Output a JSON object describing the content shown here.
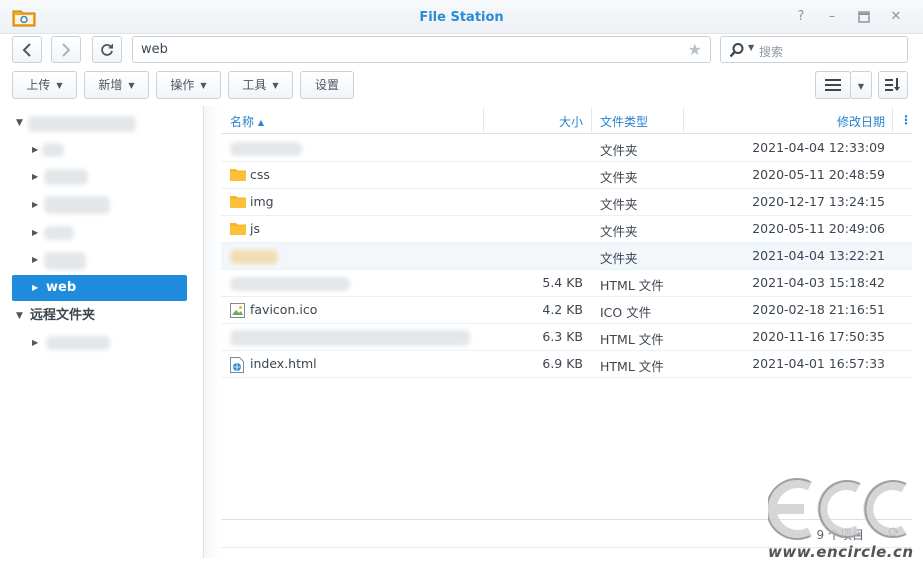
{
  "window": {
    "title": "File Station"
  },
  "toolbar": {
    "path": "web",
    "search_placeholder": "搜索",
    "buttons": {
      "upload": "上传",
      "create": "新增",
      "action": "操作",
      "tools": "工具",
      "settings": "设置"
    }
  },
  "sidebar": {
    "web_label": "web",
    "remote_label": "远程文件夹"
  },
  "table": {
    "headers": {
      "name": "名称",
      "size": "大小",
      "type": "文件类型",
      "modified": "修改日期"
    },
    "rows": [
      {
        "name": "",
        "size": "",
        "type": "文件夹",
        "modified": "2021-04-04 12:33:09",
        "icon": "folder-icon"
      },
      {
        "name": "css",
        "size": "",
        "type": "文件夹",
        "modified": "2020-05-11 20:48:59",
        "icon": "folder-icon"
      },
      {
        "name": "img",
        "size": "",
        "type": "文件夹",
        "modified": "2020-12-17 13:24:15",
        "icon": "folder-icon"
      },
      {
        "name": "js",
        "size": "",
        "type": "文件夹",
        "modified": "2020-05-11 20:49:06",
        "icon": "folder-icon"
      },
      {
        "name": "",
        "size": "",
        "type": "文件夹",
        "modified": "2021-04-04 13:22:21",
        "icon": "folder-icon"
      },
      {
        "name": "",
        "size": "5.4 KB",
        "type": "HTML 文件",
        "modified": "2021-04-03 15:18:42",
        "icon": "html-file-icon"
      },
      {
        "name": "favicon.ico",
        "size": "4.2 KB",
        "type": "ICO 文件",
        "modified": "2020-02-18 21:16:51",
        "icon": "image-file-icon"
      },
      {
        "name": "",
        "size": "6.3 KB",
        "type": "HTML 文件",
        "modified": "2020-11-16 17:50:35",
        "icon": "html-file-icon"
      },
      {
        "name": "index.html",
        "size": "6.9 KB",
        "type": "HTML 文件",
        "modified": "2021-04-01 16:57:33",
        "icon": "html-file-icon"
      }
    ]
  },
  "footer": {
    "item_count": "9 个项目"
  },
  "watermark": {
    "logo_text": "ECC",
    "url": "www.encircle.cn"
  },
  "colors": {
    "accent": "#1e8bdd",
    "folder": "#f7b52a",
    "title": "#2a8bd6"
  }
}
